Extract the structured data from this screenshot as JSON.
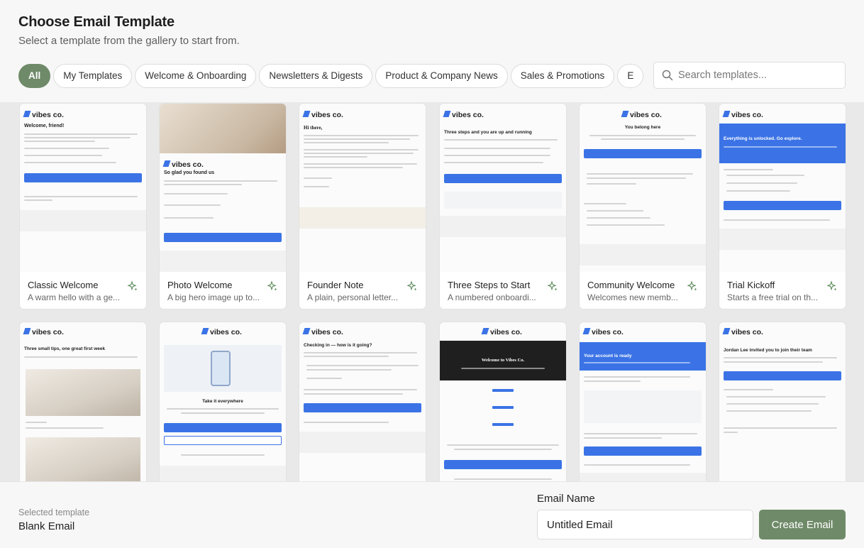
{
  "header": {
    "title": "Choose Email Template",
    "subtitle": "Select a template from the gallery to start from."
  },
  "filters": [
    {
      "label": "All",
      "active": true
    },
    {
      "label": "My Templates",
      "active": false
    },
    {
      "label": "Welcome & Onboarding",
      "active": false
    },
    {
      "label": "Newsletters & Digests",
      "active": false
    },
    {
      "label": "Product & Company News",
      "active": false
    },
    {
      "label": "Sales & Promotions",
      "active": false
    },
    {
      "label": "E",
      "active": false
    }
  ],
  "search": {
    "placeholder": "Search templates...",
    "icon": "search-icon"
  },
  "templates": [
    {
      "name": "Classic Welcome",
      "description": "A warm hello with a ge...",
      "icon": "sparkle-icon"
    },
    {
      "name": "Photo Welcome",
      "description": "A big hero image up to...",
      "icon": "sparkle-icon"
    },
    {
      "name": "Founder Note",
      "description": "A plain, personal letter...",
      "icon": "sparkle-icon"
    },
    {
      "name": "Three Steps to Start",
      "description": "A numbered onboardi...",
      "icon": "sparkle-icon"
    },
    {
      "name": "Community Welcome",
      "description": "Welcomes new memb...",
      "icon": "sparkle-icon"
    },
    {
      "name": "Trial Kickoff",
      "description": "Starts a free trial on th...",
      "icon": "sparkle-icon"
    }
  ],
  "previews": {
    "brand": "vibes co.",
    "row1": [
      {
        "heading": "Welcome, friend!"
      },
      {
        "heading": "So glad you found us"
      },
      {
        "heading": "Hi there,"
      },
      {
        "heading": "Three steps and you are up and running"
      },
      {
        "heading": "You belong here"
      },
      {
        "heading": "Everything is unlocked. Go explore."
      }
    ],
    "row2": [
      {
        "heading": "Three small tips, one great first week"
      },
      {
        "heading": "Take it everywhere"
      },
      {
        "heading": "Checking in — how is it going?"
      },
      {
        "heading": "Welcome to Vibes Co."
      },
      {
        "heading": "Your account is ready"
      },
      {
        "heading": "Jordan Lee invited you to join their team"
      }
    ]
  },
  "footer": {
    "selected_label": "Selected template",
    "selected_value": "Blank Email",
    "email_name_label": "Email Name",
    "email_name_value": "Untitled Email",
    "create_label": "Create Email"
  },
  "colors": {
    "accent": "#6f8a68",
    "brand_blue": "#3b73e6"
  }
}
